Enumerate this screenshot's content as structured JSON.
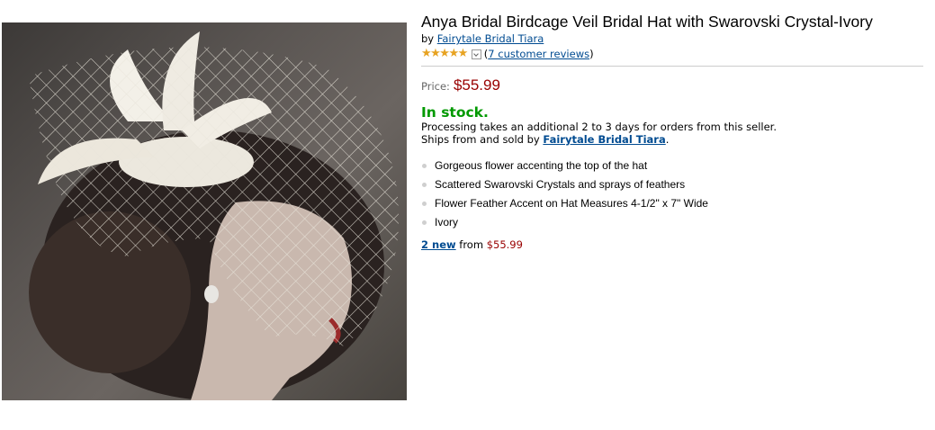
{
  "product": {
    "title": "Anya Bridal Birdcage Veil Bridal Hat with Swarovski Crystal-Ivory",
    "by_prefix": "by",
    "brand": "Fairytale Bridal Tiara",
    "rating_stars": 5,
    "reviews_open": "(",
    "reviews_link": "7 customer reviews",
    "reviews_close": ")",
    "price_label": "Price:",
    "price": "$55.99",
    "availability": "In stock.",
    "processing": "Processing takes an additional 2 to 3 days for orders from this seller.",
    "ships_prefix": "Ships from and sold by",
    "seller": "Fairytale Bridal Tiara",
    "ships_suffix": ".",
    "bullets": [
      "Gorgeous flower accenting the top of the hat",
      "Scattered Swarovski Crystals and sprays of feathers",
      "Flower Feather Accent on Hat Measures 4-1/2\" x 7\" Wide",
      "Ivory"
    ],
    "offers_link": "2 new",
    "offers_from": "from",
    "offers_price": "$55.99"
  },
  "colors": {
    "link": "#004b91",
    "price": "#990000",
    "in_stock": "#009900",
    "star": "#e7a322"
  },
  "icons": {
    "stars": "star-rating-icon",
    "dropdown": "chevron-down-icon"
  }
}
